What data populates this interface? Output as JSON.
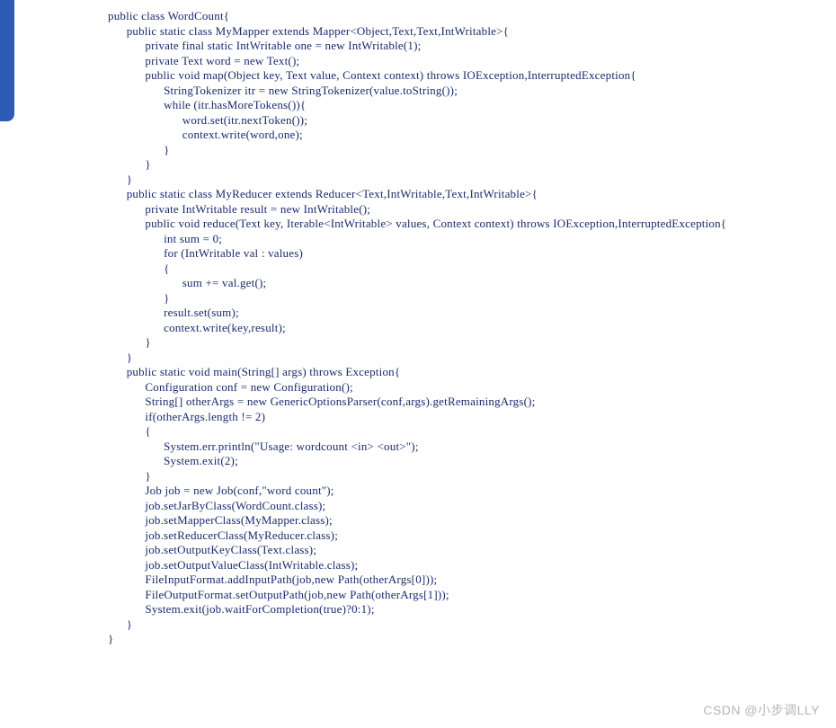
{
  "code": "public class WordCount{\n      public static class MyMapper extends Mapper<Object,Text,Text,IntWritable>{\n            private final static IntWritable one = new IntWritable(1);\n            private Text word = new Text();\n            public void map(Object key, Text value, Context context) throws IOException,InterruptedException{\n                  StringTokenizer itr = new StringTokenizer(value.toString());\n                  while (itr.hasMoreTokens()){\n                        word.set(itr.nextToken());\n                        context.write(word,one);\n                  }\n            }\n      }\n      public static class MyReducer extends Reducer<Text,IntWritable,Text,IntWritable>{\n            private IntWritable result = new IntWritable();\n            public void reduce(Text key, Iterable<IntWritable> values, Context context) throws IOException,InterruptedException{\n                  int sum = 0;\n                  for (IntWritable val : values)\n                  {\n                        sum += val.get();\n                  }\n                  result.set(sum);\n                  context.write(key,result);\n            }\n      }\n      public static void main(String[] args) throws Exception{\n            Configuration conf = new Configuration();\n            String[] otherArgs = new GenericOptionsParser(conf,args).getRemainingArgs();\n            if(otherArgs.length != 2)\n            {\n                  System.err.println(\"Usage: wordcount <in> <out>\");\n                  System.exit(2);\n            }\n            Job job = new Job(conf,\"word count\");\n            job.setJarByClass(WordCount.class);\n            job.setMapperClass(MyMapper.class);\n            job.setReducerClass(MyReducer.class);\n            job.setOutputKeyClass(Text.class);\n            job.setOutputValueClass(IntWritable.class);\n            FileInputFormat.addInputPath(job,new Path(otherArgs[0]));\n            FileOutputFormat.setOutputPath(job,new Path(otherArgs[1]));\n            System.exit(job.waitForCompletion(true)?0:1);\n      }\n}",
  "watermark": "CSDN @小步调LLY"
}
